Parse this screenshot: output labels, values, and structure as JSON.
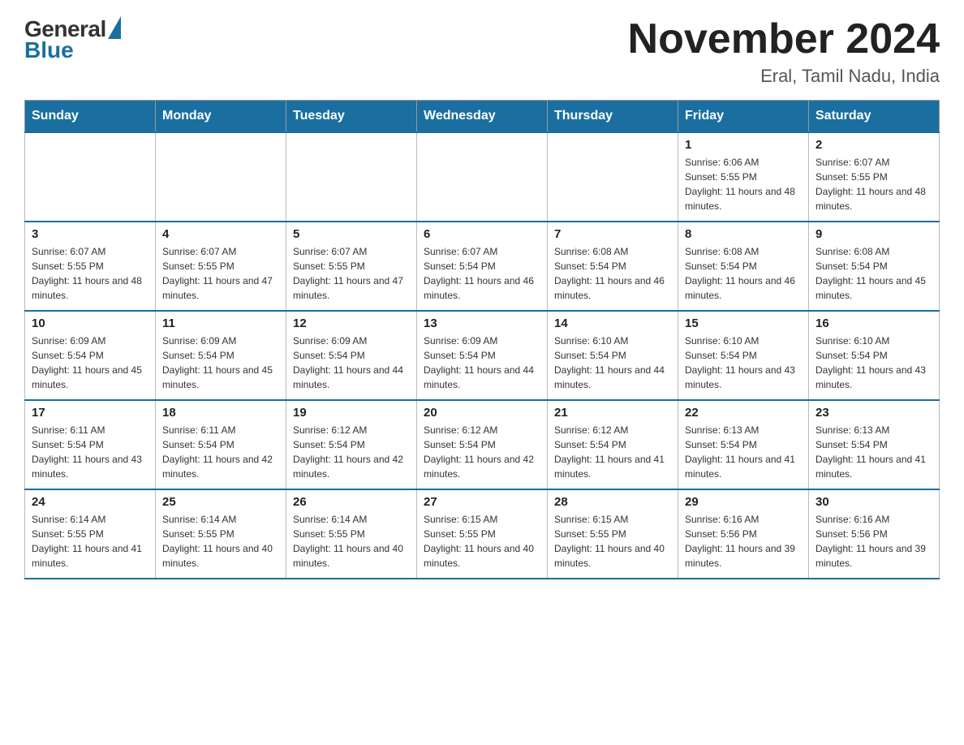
{
  "logo": {
    "general": "General",
    "blue": "Blue"
  },
  "title": "November 2024",
  "subtitle": "Eral, Tamil Nadu, India",
  "days_of_week": [
    "Sunday",
    "Monday",
    "Tuesday",
    "Wednesday",
    "Thursday",
    "Friday",
    "Saturday"
  ],
  "weeks": [
    [
      {
        "day": "",
        "sunrise": "",
        "sunset": "",
        "daylight": ""
      },
      {
        "day": "",
        "sunrise": "",
        "sunset": "",
        "daylight": ""
      },
      {
        "day": "",
        "sunrise": "",
        "sunset": "",
        "daylight": ""
      },
      {
        "day": "",
        "sunrise": "",
        "sunset": "",
        "daylight": ""
      },
      {
        "day": "",
        "sunrise": "",
        "sunset": "",
        "daylight": ""
      },
      {
        "day": "1",
        "sunrise": "Sunrise: 6:06 AM",
        "sunset": "Sunset: 5:55 PM",
        "daylight": "Daylight: 11 hours and 48 minutes."
      },
      {
        "day": "2",
        "sunrise": "Sunrise: 6:07 AM",
        "sunset": "Sunset: 5:55 PM",
        "daylight": "Daylight: 11 hours and 48 minutes."
      }
    ],
    [
      {
        "day": "3",
        "sunrise": "Sunrise: 6:07 AM",
        "sunset": "Sunset: 5:55 PM",
        "daylight": "Daylight: 11 hours and 48 minutes."
      },
      {
        "day": "4",
        "sunrise": "Sunrise: 6:07 AM",
        "sunset": "Sunset: 5:55 PM",
        "daylight": "Daylight: 11 hours and 47 minutes."
      },
      {
        "day": "5",
        "sunrise": "Sunrise: 6:07 AM",
        "sunset": "Sunset: 5:55 PM",
        "daylight": "Daylight: 11 hours and 47 minutes."
      },
      {
        "day": "6",
        "sunrise": "Sunrise: 6:07 AM",
        "sunset": "Sunset: 5:54 PM",
        "daylight": "Daylight: 11 hours and 46 minutes."
      },
      {
        "day": "7",
        "sunrise": "Sunrise: 6:08 AM",
        "sunset": "Sunset: 5:54 PM",
        "daylight": "Daylight: 11 hours and 46 minutes."
      },
      {
        "day": "8",
        "sunrise": "Sunrise: 6:08 AM",
        "sunset": "Sunset: 5:54 PM",
        "daylight": "Daylight: 11 hours and 46 minutes."
      },
      {
        "day": "9",
        "sunrise": "Sunrise: 6:08 AM",
        "sunset": "Sunset: 5:54 PM",
        "daylight": "Daylight: 11 hours and 45 minutes."
      }
    ],
    [
      {
        "day": "10",
        "sunrise": "Sunrise: 6:09 AM",
        "sunset": "Sunset: 5:54 PM",
        "daylight": "Daylight: 11 hours and 45 minutes."
      },
      {
        "day": "11",
        "sunrise": "Sunrise: 6:09 AM",
        "sunset": "Sunset: 5:54 PM",
        "daylight": "Daylight: 11 hours and 45 minutes."
      },
      {
        "day": "12",
        "sunrise": "Sunrise: 6:09 AM",
        "sunset": "Sunset: 5:54 PM",
        "daylight": "Daylight: 11 hours and 44 minutes."
      },
      {
        "day": "13",
        "sunrise": "Sunrise: 6:09 AM",
        "sunset": "Sunset: 5:54 PM",
        "daylight": "Daylight: 11 hours and 44 minutes."
      },
      {
        "day": "14",
        "sunrise": "Sunrise: 6:10 AM",
        "sunset": "Sunset: 5:54 PM",
        "daylight": "Daylight: 11 hours and 44 minutes."
      },
      {
        "day": "15",
        "sunrise": "Sunrise: 6:10 AM",
        "sunset": "Sunset: 5:54 PM",
        "daylight": "Daylight: 11 hours and 43 minutes."
      },
      {
        "day": "16",
        "sunrise": "Sunrise: 6:10 AM",
        "sunset": "Sunset: 5:54 PM",
        "daylight": "Daylight: 11 hours and 43 minutes."
      }
    ],
    [
      {
        "day": "17",
        "sunrise": "Sunrise: 6:11 AM",
        "sunset": "Sunset: 5:54 PM",
        "daylight": "Daylight: 11 hours and 43 minutes."
      },
      {
        "day": "18",
        "sunrise": "Sunrise: 6:11 AM",
        "sunset": "Sunset: 5:54 PM",
        "daylight": "Daylight: 11 hours and 42 minutes."
      },
      {
        "day": "19",
        "sunrise": "Sunrise: 6:12 AM",
        "sunset": "Sunset: 5:54 PM",
        "daylight": "Daylight: 11 hours and 42 minutes."
      },
      {
        "day": "20",
        "sunrise": "Sunrise: 6:12 AM",
        "sunset": "Sunset: 5:54 PM",
        "daylight": "Daylight: 11 hours and 42 minutes."
      },
      {
        "day": "21",
        "sunrise": "Sunrise: 6:12 AM",
        "sunset": "Sunset: 5:54 PM",
        "daylight": "Daylight: 11 hours and 41 minutes."
      },
      {
        "day": "22",
        "sunrise": "Sunrise: 6:13 AM",
        "sunset": "Sunset: 5:54 PM",
        "daylight": "Daylight: 11 hours and 41 minutes."
      },
      {
        "day": "23",
        "sunrise": "Sunrise: 6:13 AM",
        "sunset": "Sunset: 5:54 PM",
        "daylight": "Daylight: 11 hours and 41 minutes."
      }
    ],
    [
      {
        "day": "24",
        "sunrise": "Sunrise: 6:14 AM",
        "sunset": "Sunset: 5:55 PM",
        "daylight": "Daylight: 11 hours and 41 minutes."
      },
      {
        "day": "25",
        "sunrise": "Sunrise: 6:14 AM",
        "sunset": "Sunset: 5:55 PM",
        "daylight": "Daylight: 11 hours and 40 minutes."
      },
      {
        "day": "26",
        "sunrise": "Sunrise: 6:14 AM",
        "sunset": "Sunset: 5:55 PM",
        "daylight": "Daylight: 11 hours and 40 minutes."
      },
      {
        "day": "27",
        "sunrise": "Sunrise: 6:15 AM",
        "sunset": "Sunset: 5:55 PM",
        "daylight": "Daylight: 11 hours and 40 minutes."
      },
      {
        "day": "28",
        "sunrise": "Sunrise: 6:15 AM",
        "sunset": "Sunset: 5:55 PM",
        "daylight": "Daylight: 11 hours and 40 minutes."
      },
      {
        "day": "29",
        "sunrise": "Sunrise: 6:16 AM",
        "sunset": "Sunset: 5:56 PM",
        "daylight": "Daylight: 11 hours and 39 minutes."
      },
      {
        "day": "30",
        "sunrise": "Sunrise: 6:16 AM",
        "sunset": "Sunset: 5:56 PM",
        "daylight": "Daylight: 11 hours and 39 minutes."
      }
    ]
  ]
}
